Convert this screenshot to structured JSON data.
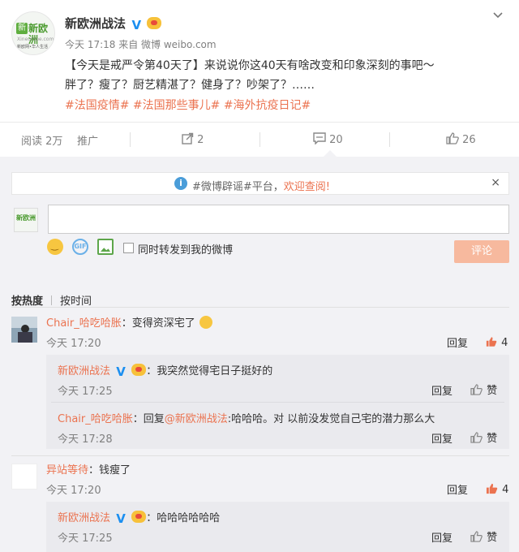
{
  "post": {
    "avatar_text": "新欧洲",
    "avatar_subtitle": "Xineurope.com",
    "avatar_tagline": "新欧网•华人生活",
    "author": "新欧洲战法",
    "verified_mark": "V",
    "time": "今天 17:18",
    "source": "来自 微博 weibo.com",
    "content_line1": "【今天是戒严令第40天了】来说说你这40天有啥改变和印象深刻的事吧～",
    "content_line2": "胖了？瘦了？厨艺精湛了？健身了？吵架了？……",
    "tags": "#法国疫情# #法国那些事儿# #海外抗疫日记#",
    "more_icon": "chevron-down-icon"
  },
  "actions": {
    "reads": "阅读 2万",
    "promote": "推广",
    "share_count": "2",
    "comment_count": "20",
    "like_count": "26"
  },
  "notice": {
    "info": "i",
    "text_pre": "#微博辟谣#平台，",
    "text_link": "欢迎查阅!",
    "close": "×"
  },
  "composer": {
    "avatar_text": "新欧洲",
    "placeholder": "",
    "gif": "GIF",
    "forward_label": "同时转发到我的微博",
    "submit": "评论"
  },
  "sort": {
    "hot": "按热度",
    "time": "按时间"
  },
  "comments": [
    {
      "user": "Chair_哈吃哈胀",
      "text": "：变得资深宅了",
      "time": "今天 17:20",
      "reply": "回复",
      "likes": "4",
      "replies": [
        {
          "user": "新欧洲战法",
          "verified_mark": "V",
          "text": "：我突然觉得宅日子挺好的",
          "time": "今天 17:25",
          "reply": "回复",
          "like": "赞"
        },
        {
          "user": "Chair_哈吃哈胀",
          "text_pre": "：回复",
          "mention": "@新欧洲战法",
          "text": ":哈哈哈。对 以前没发觉自己宅的潜力那么大",
          "time": "今天 17:28",
          "reply": "回复",
          "like": "赞"
        }
      ]
    },
    {
      "user": "异站等待",
      "text": "：钱瘦了",
      "time": "今天 17:20",
      "reply": "回复",
      "likes": "4",
      "replies": [
        {
          "user": "新欧洲战法",
          "verified_mark": "V",
          "text": "：哈哈哈哈哈哈",
          "time": "今天 17:25",
          "reply": "回复",
          "like": "赞"
        }
      ]
    }
  ],
  "colors": {
    "accent": "#eb7350",
    "verified": "#1c8ff0",
    "panel": "#f2f2f5",
    "sub_panel": "#eaeaee"
  }
}
